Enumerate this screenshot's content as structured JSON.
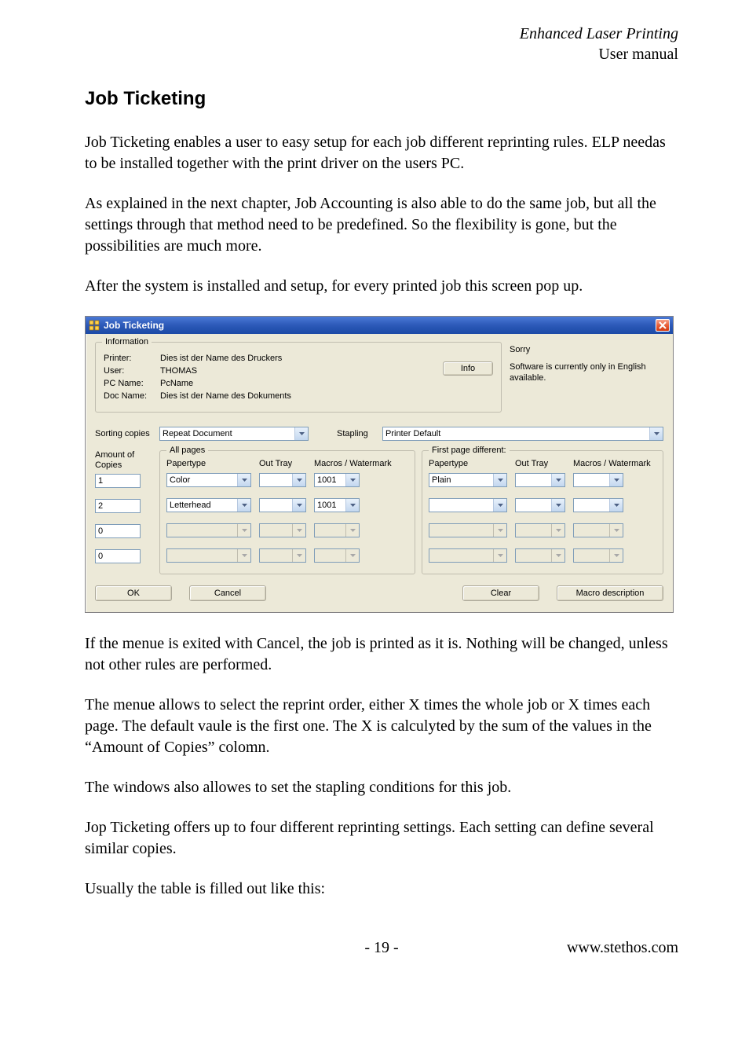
{
  "header": {
    "title_italic": "Enhanced Laser Printing",
    "subtitle": "User manual"
  },
  "section_title": "Job Ticketing",
  "paragraphs": {
    "p1": "Job Ticketing enables a user to easy setup for each job different reprinting rules. ELP needas to be installed together with the print driver on the users PC.",
    "p2": "As explained in the next chapter, Job Accounting is also able to do the same job, but all the settings through that method need to be predefined. So the flexibility is gone, but the possibilities are much more.",
    "p3": "After the system is installed and setup, for every printed job this screen pop up.",
    "p4": "If the menue is exited with Cancel, the job is printed as it is. Nothing will be changed, unless not other rules are performed.",
    "p5": "The menue allows to select the reprint order, either X times the whole job or X times each page. The default vaule is the first one. The X is calculyted by the sum of the values in the “Amount of Copies” colomn.",
    "p6": "The windows also allowes to set the stapling conditions for this job.",
    "p7": "Jop Ticketing offers up to four different reprinting settings. Each setting can define several similar copies.",
    "p8": "Usually the table is filled out like this:"
  },
  "dialog": {
    "title": "Job Ticketing",
    "info_group": {
      "legend": "Information",
      "rows": [
        {
          "label": "Printer:",
          "value": "Dies ist der Name des Druckers"
        },
        {
          "label": "User:",
          "value": "THOMAS"
        },
        {
          "label": "PC Name:",
          "value": "PcName"
        },
        {
          "label": "Doc Name:",
          "value": "Dies ist der Name des Dokuments"
        }
      ],
      "info_button": "Info"
    },
    "sidebox": {
      "line1": "Sorry",
      "line2": "Software is currently only in English available."
    },
    "sorting": {
      "label": "Sorting copies",
      "value": "Repeat Document",
      "stapling_label": "Stapling",
      "stapling_value": "Printer Default"
    },
    "columns": {
      "amount_header": "Amount of Copies",
      "amounts": [
        "1",
        "2",
        "0",
        "0"
      ],
      "all_pages_legend": "All pages",
      "first_page_legend": "First page different:",
      "headers": {
        "papertype": "Papertype",
        "outtray": "Out Tray",
        "macros": "Macros / Watermark"
      },
      "all_pages_rows": [
        {
          "papertype": "Color",
          "outtray": "",
          "macros": "1001",
          "enabled": true
        },
        {
          "papertype": "Letterhead",
          "outtray": "",
          "macros": "1001",
          "enabled": true
        },
        {
          "papertype": "",
          "outtray": "",
          "macros": "",
          "enabled": false
        },
        {
          "papertype": "",
          "outtray": "",
          "macros": "",
          "enabled": false
        }
      ],
      "first_page_rows": [
        {
          "papertype": "Plain",
          "outtray": "",
          "macros": "",
          "enabled": true
        },
        {
          "papertype": "",
          "outtray": "",
          "macros": "",
          "enabled": true
        },
        {
          "papertype": "",
          "outtray": "",
          "macros": "",
          "enabled": false
        },
        {
          "papertype": "",
          "outtray": "",
          "macros": "",
          "enabled": false
        }
      ]
    },
    "buttons": {
      "ok": "OK",
      "cancel": "Cancel",
      "clear": "Clear",
      "macro": "Macro description"
    }
  },
  "footer": {
    "page": "- 19 -",
    "site": "www.stethos.com"
  }
}
